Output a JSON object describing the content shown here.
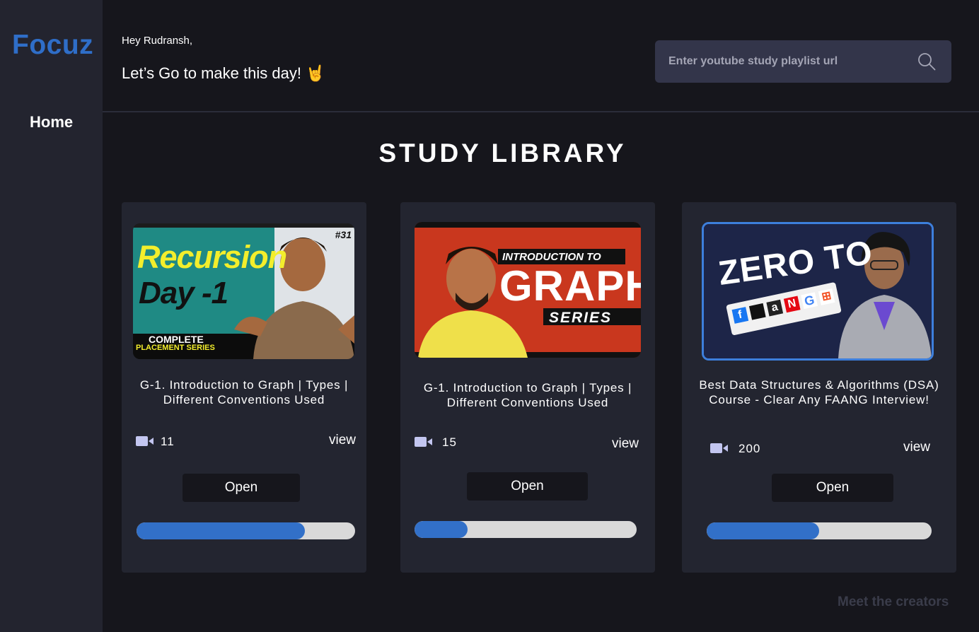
{
  "sidebar": {
    "logo": "Focuz",
    "nav": {
      "home": "Home"
    }
  },
  "header": {
    "greeting": "Hey Rudransh,",
    "tagline": "Let’s Go to make this day! 🤘",
    "search": {
      "placeholder": "Enter youtube study playlist url",
      "value": ""
    }
  },
  "library": {
    "title": "STUDY LIBRARY",
    "cards": [
      {
        "title": "G-1. Introduction to Graph | Types | Different Conventions Used",
        "video_count": "11",
        "view_label": "view",
        "open_label": "Open",
        "progress": 0.77,
        "thumbnail": {
          "badge": "#31",
          "line1": "Recursion",
          "line2": "Day -1",
          "footer1": "COMPLETE",
          "footer2": "PLACEMENT SERIES"
        }
      },
      {
        "title": "G-1. Introduction to Graph | Types | Different Conventions Used",
        "video_count": "15",
        "view_label": "view",
        "open_label": "Open",
        "progress": 0.24,
        "thumbnail": {
          "line1": "INTRODUCTION TO",
          "line2": "GRAPH",
          "line3": "SERIES"
        }
      },
      {
        "title": "Best Data Structures & Algorithms (DSA) Course - Clear Any FAANG Interview!",
        "video_count": "200",
        "view_label": "view",
        "open_label": "Open",
        "progress": 0.5,
        "thumbnail": {
          "line1": "ZERO TO",
          "logos": [
            "f",
            "",
            "a",
            "N",
            "G",
            "⊞"
          ]
        }
      }
    ]
  },
  "footer": {
    "creators_link": "Meet the creators"
  },
  "colors": {
    "accent": "#3270c8",
    "logo": "#2f6ec8",
    "card_bg": "#232530",
    "page_bg": "#16161c"
  }
}
